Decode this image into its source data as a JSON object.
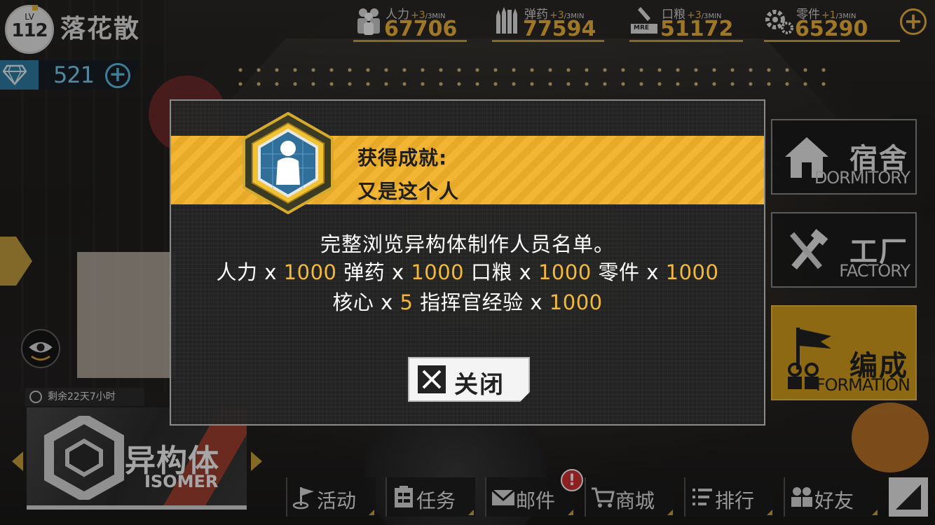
{
  "player": {
    "lv_label": "LV",
    "level": "112",
    "name": "落花散",
    "gems": "521"
  },
  "resources": [
    {
      "name": "人力",
      "rate": "+3",
      "per": "/3MIN",
      "value": "67706",
      "icon": "manpower-icon"
    },
    {
      "name": "弹药",
      "rate": "+3",
      "per": "/3MIN",
      "value": "77594",
      "icon": "ammo-icon"
    },
    {
      "name": "口粮",
      "rate": "+3",
      "per": "/3MIN",
      "value": "51172",
      "icon": "rations-icon",
      "tag": "MRE"
    },
    {
      "name": "零件",
      "rate": "+1",
      "per": "/3MIN",
      "value": "65290",
      "icon": "parts-icon"
    }
  ],
  "side_menu": [
    {
      "zh": "宿舍",
      "en": "DORMITORY",
      "icon": "house-icon"
    },
    {
      "zh": "工厂",
      "en": "FACTORY",
      "icon": "tools-icon"
    },
    {
      "zh": "编成",
      "en": "FORMATION",
      "icon": "flag-icon"
    }
  ],
  "event": {
    "remaining": "剩余22天7小时",
    "zh": "异构体",
    "en": "ISOMER",
    "progress": 0.72
  },
  "bottom_nav": [
    {
      "label": "活动",
      "icon": "event-icon"
    },
    {
      "label": "任务",
      "icon": "task-icon"
    },
    {
      "label": "邮件",
      "icon": "mail-icon"
    },
    {
      "label": "商城",
      "icon": "cart-icon"
    },
    {
      "label": "排行",
      "icon": "ranking-icon"
    },
    {
      "label": "好友",
      "icon": "friends-icon"
    }
  ],
  "mail_alert": "!",
  "dialog": {
    "label": "获得成就:",
    "title": "又是这个人",
    "description": "完整浏览异构体制作人员名单。",
    "rewards": [
      {
        "name": "人力",
        "amount": "1000"
      },
      {
        "name": "弹药",
        "amount": "1000"
      },
      {
        "name": "口粮",
        "amount": "1000"
      },
      {
        "name": "零件",
        "amount": "1000"
      },
      {
        "name": "核心",
        "amount": "5"
      },
      {
        "name": "指挥官经验",
        "amount": "1000"
      }
    ],
    "multiplier": "x",
    "close_label": "关闭"
  },
  "colors": {
    "accent": "#f3b93c",
    "gem": "#7fd2f4",
    "alert": "#d93232"
  }
}
